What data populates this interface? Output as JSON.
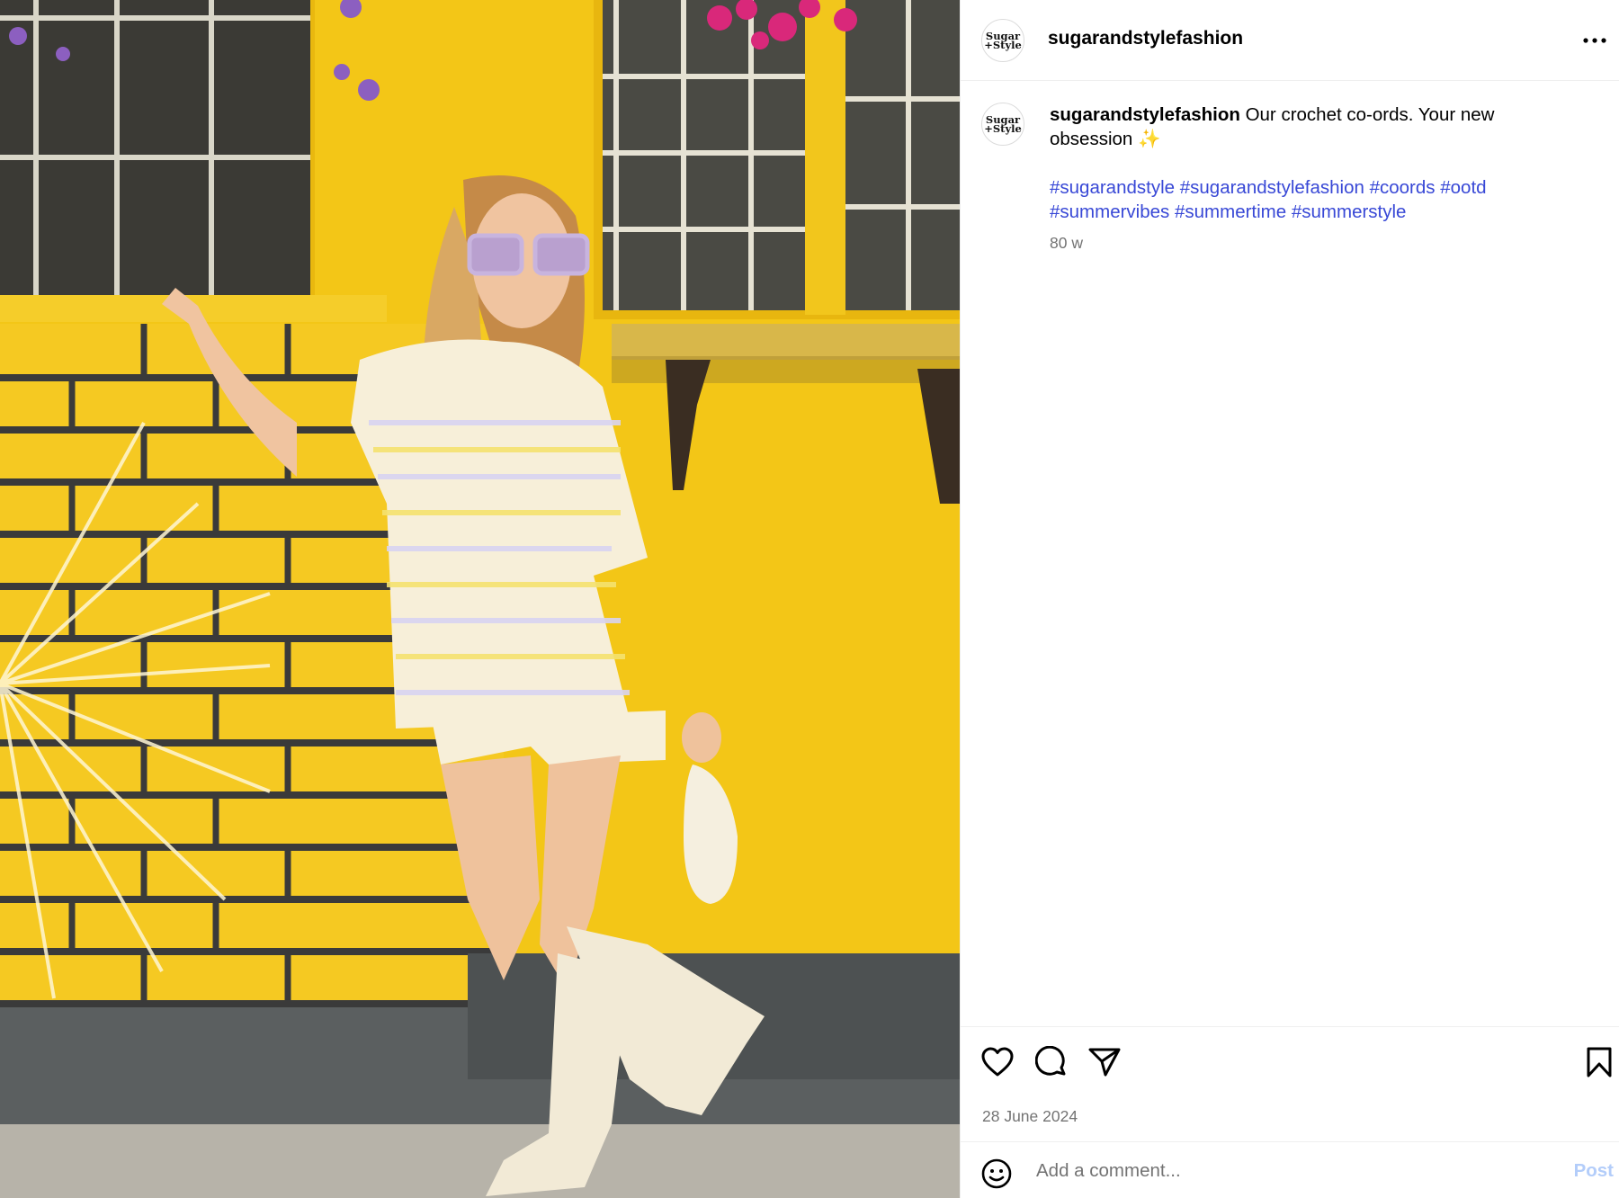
{
  "post": {
    "username": "sugarandstylefashion",
    "avatar_text": [
      "Sugar",
      "+Style"
    ],
    "caption_user": "sugarandstylefashion",
    "caption_text": " Our crochet co-ords. Your new obsession ",
    "caption_emoji": "✨",
    "hashtags": [
      "#sugarandstyle",
      "#sugarandstylefashion",
      "#coords",
      "#ootd",
      "#summervibes",
      "#summertime",
      "#summerstyle"
    ],
    "age": "80 w",
    "date": "28 June 2024"
  },
  "comment": {
    "placeholder": "Add a comment...",
    "post_label": "Post"
  },
  "icons": {
    "more": "more-options-icon",
    "like": "heart-icon",
    "comment": "comment-icon",
    "share": "share-icon",
    "save": "bookmark-icon",
    "emoji": "emoji-icon"
  },
  "colors": {
    "hashtag": "#3848d6",
    "muted": "#737373",
    "post_button": "#b3cdfa",
    "wall_yellow": "#f2c81a"
  }
}
